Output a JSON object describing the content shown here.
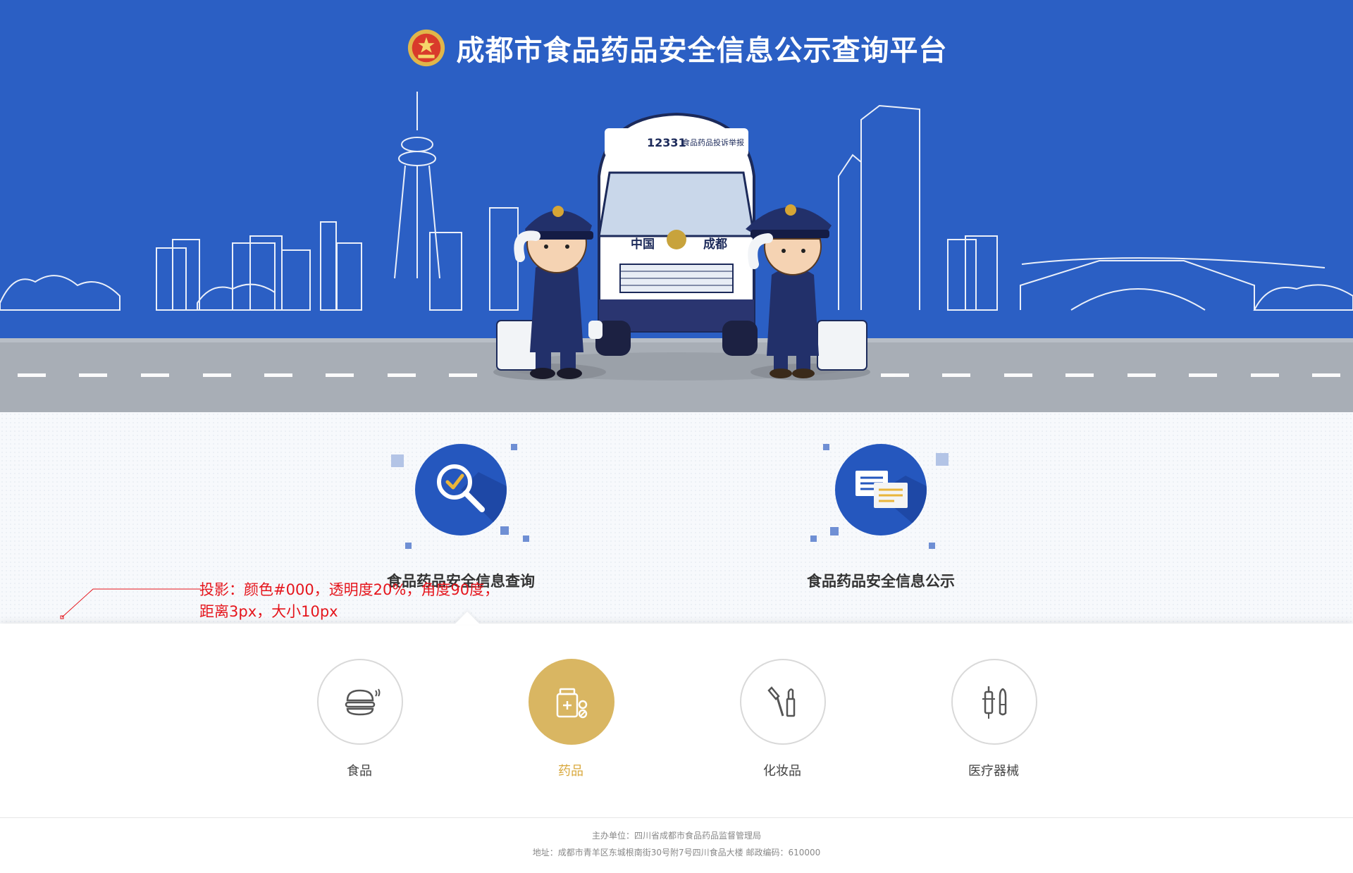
{
  "header": {
    "title": "成都市食品药品安全信息公示查询平台",
    "emblem_icon": "national-emblem-icon"
  },
  "hero": {
    "van_plate_number": "12331",
    "van_plate_text": "食品药品投诉举报",
    "van_side_left": "中国",
    "van_side_right": "成都"
  },
  "features": [
    {
      "label": "食品药品安全信息查询",
      "icon": "magnifier-check-icon"
    },
    {
      "label": "食品药品安全信息公示",
      "icon": "documents-icon"
    }
  ],
  "annotation": {
    "text": "投影：颜色#000，透明度20%，角度90度，距离3px，大小10px",
    "color": "#e5151c"
  },
  "categories": [
    {
      "label": "食品",
      "icon": "burger-icon",
      "active": false
    },
    {
      "label": "药品",
      "icon": "medicine-bottle-icon",
      "active": true
    },
    {
      "label": "化妆品",
      "icon": "cosmetics-icon",
      "active": false
    },
    {
      "label": "医疗器械",
      "icon": "medical-device-icon",
      "active": false
    }
  ],
  "footer": {
    "line1": "主办单位：四川省成都市食品药品监督管理局",
    "line2": "地址：成都市青羊区东城根南街30号附7号四川食品大楼    邮政编码：610000"
  },
  "colors": {
    "primary_blue": "#2557be",
    "sky_blue": "#2b5fc4",
    "accent_gold": "#d9b662",
    "road_gray": "#a8aeb6"
  }
}
